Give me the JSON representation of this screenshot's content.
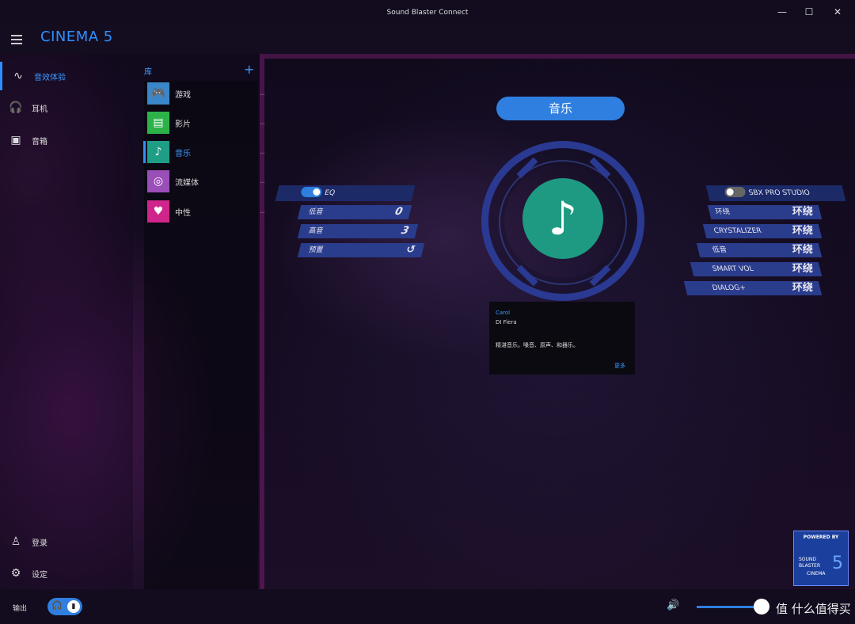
{
  "window": {
    "title": "Sound Blaster Connect",
    "minimize": "—",
    "maximize": "☐",
    "close": "✕"
  },
  "header": {
    "brand": "CINEMA 5",
    "menu_icon": "hamburger-icon"
  },
  "nav": {
    "items": [
      {
        "label": "音效体验",
        "icon": "waveform-icon",
        "glyph": "∿"
      },
      {
        "label": "耳机",
        "icon": "headphones-icon",
        "glyph": "🎧"
      },
      {
        "label": "音箱",
        "icon": "speaker-icon",
        "glyph": "▣"
      }
    ],
    "bottom": [
      {
        "label": "登录",
        "icon": "user-icon",
        "glyph": "♙"
      },
      {
        "label": "设定",
        "icon": "gear-icon",
        "glyph": "⚙"
      }
    ]
  },
  "library": {
    "title": "库",
    "add": "+",
    "items": [
      {
        "label": "游戏",
        "icon": "gamepad-icon",
        "glyph": "🎮",
        "color": "#3b86c8"
      },
      {
        "label": "影片",
        "icon": "film-icon",
        "glyph": "▤",
        "color": "#2db24a"
      },
      {
        "label": "音乐",
        "icon": "music-note-icon",
        "glyph": "♪",
        "color": "#1f9e86"
      },
      {
        "label": "流媒体",
        "icon": "stream-icon",
        "glyph": "◎",
        "color": "#9a4fb8"
      },
      {
        "label": "中性",
        "icon": "heart-icon",
        "glyph": "♥",
        "color": "#d0258a"
      }
    ],
    "more": "···"
  },
  "profile": {
    "title": "音乐",
    "disc_glyph": "♪",
    "disc_color": "#1e9a82"
  },
  "eq": {
    "toggle_label": "EQ",
    "rows": [
      {
        "label": "低音",
        "value": "0"
      },
      {
        "label": "高音",
        "value": "3"
      },
      {
        "label": "预置",
        "value": "↺"
      }
    ]
  },
  "sbx": {
    "toggle_label": "SBX PRO STUDIO",
    "rows": [
      {
        "label": "环绕",
        "value": "环绕"
      },
      {
        "label": "CRYSTALIZER",
        "value": "环绕"
      },
      {
        "label": "低音",
        "value": "环绕"
      },
      {
        "label": "SMART VOL",
        "value": "环绕"
      },
      {
        "label": "DIALOG+",
        "value": "环绕"
      }
    ]
  },
  "info": {
    "line1": "Carol",
    "line2": "DI Fiera",
    "body": "精湛音乐。嗓音、原声、和器乐。",
    "more": "更多"
  },
  "badge": {
    "line1": "POWERED BY",
    "line2": "SOUND",
    "line3": "BLASTER",
    "line4": "CINEMA",
    "num": "5"
  },
  "bottom": {
    "output": "输出",
    "output_glyph": "🎧",
    "watermark": "值 什么值得买",
    "volume_glyph": "🔊"
  },
  "colors": {
    "accent": "#2f8fff",
    "panel": "#2a3c8c"
  }
}
